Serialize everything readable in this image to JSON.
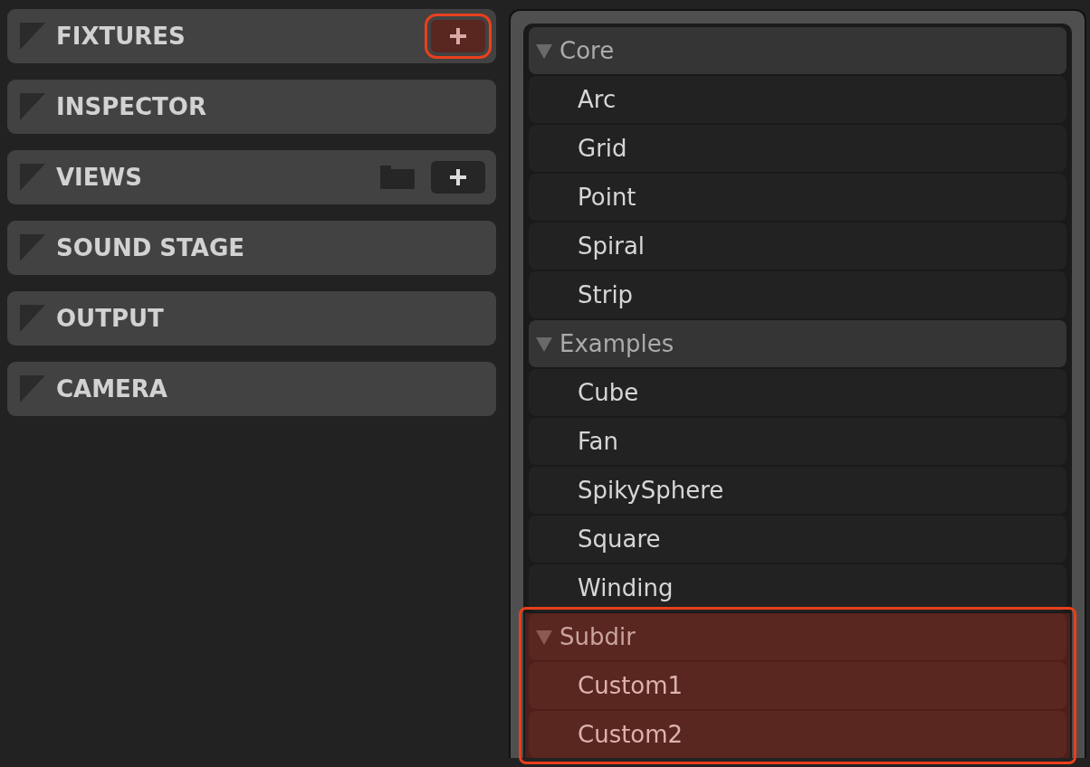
{
  "panels": [
    {
      "title": "FIXTURES",
      "buttons": [
        {
          "kind": "add",
          "highlighted": true
        }
      ]
    },
    {
      "title": "INSPECTOR"
    },
    {
      "title": "VIEWS",
      "buttons": [
        {
          "kind": "folder",
          "highlighted": false
        },
        {
          "kind": "add",
          "highlighted": false
        }
      ]
    },
    {
      "title": "SOUND STAGE"
    },
    {
      "title": "OUTPUT"
    },
    {
      "title": "CAMERA"
    }
  ],
  "fixture_menu": {
    "groups": [
      {
        "name": "Core",
        "expanded": true,
        "highlighted": false,
        "items": [
          "Arc",
          "Grid",
          "Point",
          "Spiral",
          "Strip"
        ]
      },
      {
        "name": "Examples",
        "expanded": true,
        "highlighted": false,
        "items": [
          "Cube",
          "Fan",
          "SpikySphere",
          "Square",
          "Winding"
        ]
      },
      {
        "name": "Subdir",
        "expanded": true,
        "highlighted": true,
        "items": [
          "Custom1",
          "Custom2"
        ]
      }
    ]
  }
}
